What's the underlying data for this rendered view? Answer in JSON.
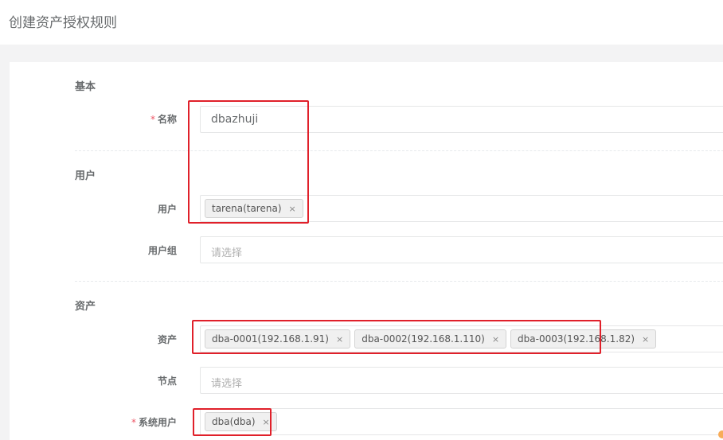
{
  "page": {
    "title": "创建资产授权规则"
  },
  "sections": {
    "basic": "基本",
    "users": "用户",
    "assets": "资产"
  },
  "fields": {
    "name": {
      "label": "名称",
      "required_mark": "*",
      "value": "dbazhuji"
    },
    "user": {
      "label": "用户",
      "tags": [
        {
          "text": "tarena(tarena)",
          "remove": "×"
        }
      ]
    },
    "user_group": {
      "label": "用户组",
      "placeholder": "请选择"
    },
    "asset": {
      "label": "资产",
      "tags": [
        {
          "text": "dba-0001(192.168.1.91)",
          "remove": "×"
        },
        {
          "text": "dba-0002(192.168.1.110)",
          "remove": "×"
        },
        {
          "text": "dba-0003(192.168.1.82)",
          "remove": "×"
        }
      ]
    },
    "node": {
      "label": "节点",
      "placeholder": "请选择"
    },
    "system_user": {
      "label": "系统用户",
      "required_mark": "*",
      "tags": [
        {
          "text": "dba(dba)",
          "remove": "×"
        }
      ]
    }
  },
  "colors": {
    "highlight": "#e0202a",
    "required": "#ed5565",
    "background": "#f3f3f4"
  }
}
